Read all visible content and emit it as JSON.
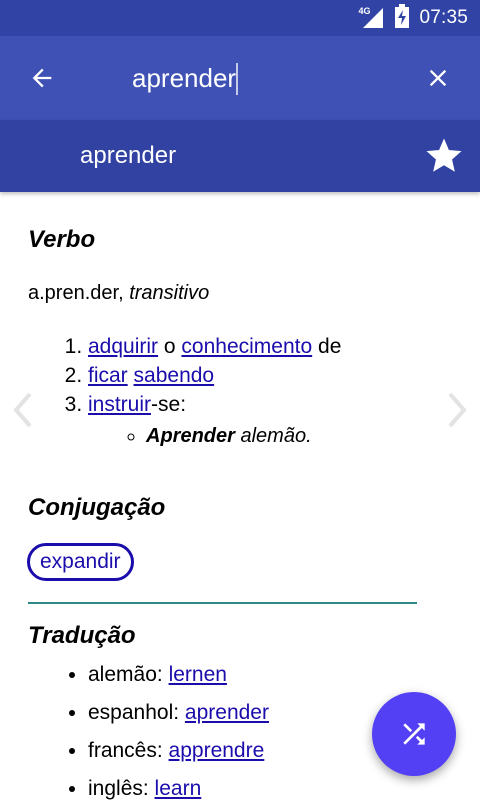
{
  "status_bar": {
    "time": "07:35",
    "network_label": "4G",
    "icons": [
      "signal-icon",
      "battery-charging-icon"
    ]
  },
  "toolbar": {
    "search_value": "aprender",
    "back_icon": "arrow-back-icon",
    "clear_icon": "close-icon",
    "bg_color": "#3f51b5"
  },
  "header": {
    "word": "aprender",
    "favorite_icon": "star-icon",
    "bg_color": "#3142a3"
  },
  "entry": {
    "part_of_speech": "Verbo",
    "syllables": "a.pren.der",
    "syllables_sep": ",",
    "transitivity": "transitivo",
    "definitions": [
      {
        "links": [
          "adquirir",
          "conhecimento"
        ],
        "connector": "o",
        "suffix": "de"
      },
      {
        "links": [
          "ficar",
          "sabendo"
        ]
      },
      {
        "links": [
          "instruir"
        ],
        "suffix": "-se:"
      }
    ],
    "example": {
      "bold": "Aprender",
      "rest": "alemão."
    }
  },
  "conjugation": {
    "heading": "Conjugação",
    "expand_label": "expandir"
  },
  "translation": {
    "heading": "Tradução",
    "items": [
      {
        "language": "alemão:",
        "word": "lernen"
      },
      {
        "language": "espanhol:",
        "word": "aprender"
      },
      {
        "language": "francês:",
        "word": "apprendre"
      },
      {
        "language": "inglês:",
        "word": "learn"
      }
    ]
  },
  "controls": {
    "prev_icon": "chevron-left-icon",
    "next_icon": "chevron-right-icon",
    "fab_icon": "shuffle-icon",
    "fab_color": "#5340f5",
    "link_color": "#1a0dab"
  }
}
